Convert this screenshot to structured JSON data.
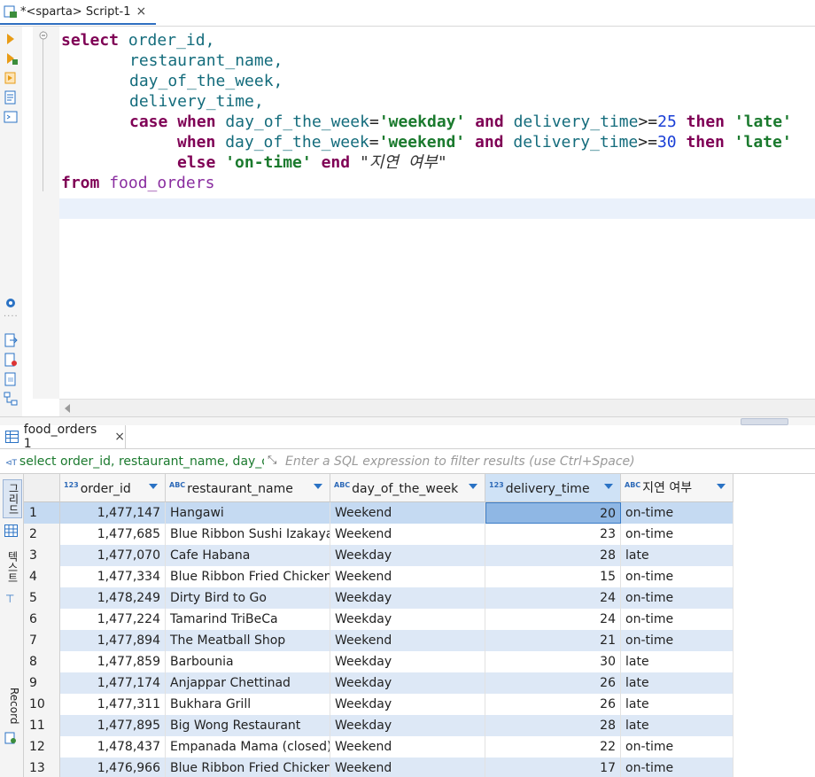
{
  "editor_tab": {
    "title": "*<sparta> Script-1",
    "close": "×"
  },
  "sql": {
    "l1": {
      "kw": "select",
      "rest": " order_id,"
    },
    "l2": "restaurant_name,",
    "l3": "day_of_the_week,",
    "l4": "delivery_time,",
    "l5": {
      "case": "case",
      "when": "when",
      "col": "day_of_the_week",
      "eq": "=",
      "val": "'weekday'",
      "and": "and",
      "col2": "delivery_time",
      "ge": ">=",
      "num": "25",
      "then": "then",
      "res": "'late'"
    },
    "l6": {
      "when": "when",
      "col": "day_of_the_week",
      "eq": "=",
      "val": "'weekend'",
      "and": "and",
      "col2": "delivery_time",
      "ge": ">=",
      "num": "30",
      "then": "then",
      "res": "'late'"
    },
    "l7": {
      "else": "else",
      "val": "'on-time'",
      "end": "end",
      "alias": "\"지연 여부\""
    },
    "l8": {
      "from": "from",
      "table": "food_orders"
    }
  },
  "results_tab": {
    "title": "food_orders 1",
    "close": "×"
  },
  "filter": {
    "query": "select order_id, restaurant_name, day_of",
    "placeholder": "Enter a SQL expression to filter results (use Ctrl+Space)"
  },
  "side_tabs": {
    "grid": "그리드",
    "text": "텍스트",
    "record": "Record"
  },
  "columns": [
    {
      "type": "123",
      "name": "order_id"
    },
    {
      "type": "ABC",
      "name": "restaurant_name"
    },
    {
      "type": "ABC",
      "name": "day_of_the_week"
    },
    {
      "type": "123",
      "name": "delivery_time"
    },
    {
      "type": "ABC",
      "name": "지연 여부"
    }
  ],
  "rows": [
    {
      "n": "1",
      "order_id": "1,477,147",
      "restaurant": "Hangawi",
      "day": "Weekend",
      "time": "20",
      "status": "on-time"
    },
    {
      "n": "2",
      "order_id": "1,477,685",
      "restaurant": "Blue Ribbon Sushi Izakaya",
      "day": "Weekend",
      "time": "23",
      "status": "on-time"
    },
    {
      "n": "3",
      "order_id": "1,477,070",
      "restaurant": "Cafe Habana",
      "day": "Weekday",
      "time": "28",
      "status": "late"
    },
    {
      "n": "4",
      "order_id": "1,477,334",
      "restaurant": "Blue Ribbon Fried Chicken",
      "day": "Weekend",
      "time": "15",
      "status": "on-time"
    },
    {
      "n": "5",
      "order_id": "1,478,249",
      "restaurant": "Dirty Bird to Go",
      "day": "Weekday",
      "time": "24",
      "status": "on-time"
    },
    {
      "n": "6",
      "order_id": "1,477,224",
      "restaurant": "Tamarind TriBeCa",
      "day": "Weekday",
      "time": "24",
      "status": "on-time"
    },
    {
      "n": "7",
      "order_id": "1,477,894",
      "restaurant": "The Meatball Shop",
      "day": "Weekend",
      "time": "21",
      "status": "on-time"
    },
    {
      "n": "8",
      "order_id": "1,477,859",
      "restaurant": "Barbounia",
      "day": "Weekday",
      "time": "30",
      "status": "late"
    },
    {
      "n": "9",
      "order_id": "1,477,174",
      "restaurant": "Anjappar Chettinad",
      "day": "Weekday",
      "time": "26",
      "status": "late"
    },
    {
      "n": "10",
      "order_id": "1,477,311",
      "restaurant": "Bukhara Grill",
      "day": "Weekday",
      "time": "26",
      "status": "late"
    },
    {
      "n": "11",
      "order_id": "1,477,895",
      "restaurant": "Big Wong Restaurant",
      "day": "Weekday",
      "time": "28",
      "status": "late"
    },
    {
      "n": "12",
      "order_id": "1,478,437",
      "restaurant": "Empanada Mama (closed)",
      "day": "Weekend",
      "time": "22",
      "status": "on-time"
    },
    {
      "n": "13",
      "order_id": "1,476,966",
      "restaurant": "Blue Ribbon Fried Chicken",
      "day": "Weekend",
      "time": "17",
      "status": "on-time"
    }
  ]
}
